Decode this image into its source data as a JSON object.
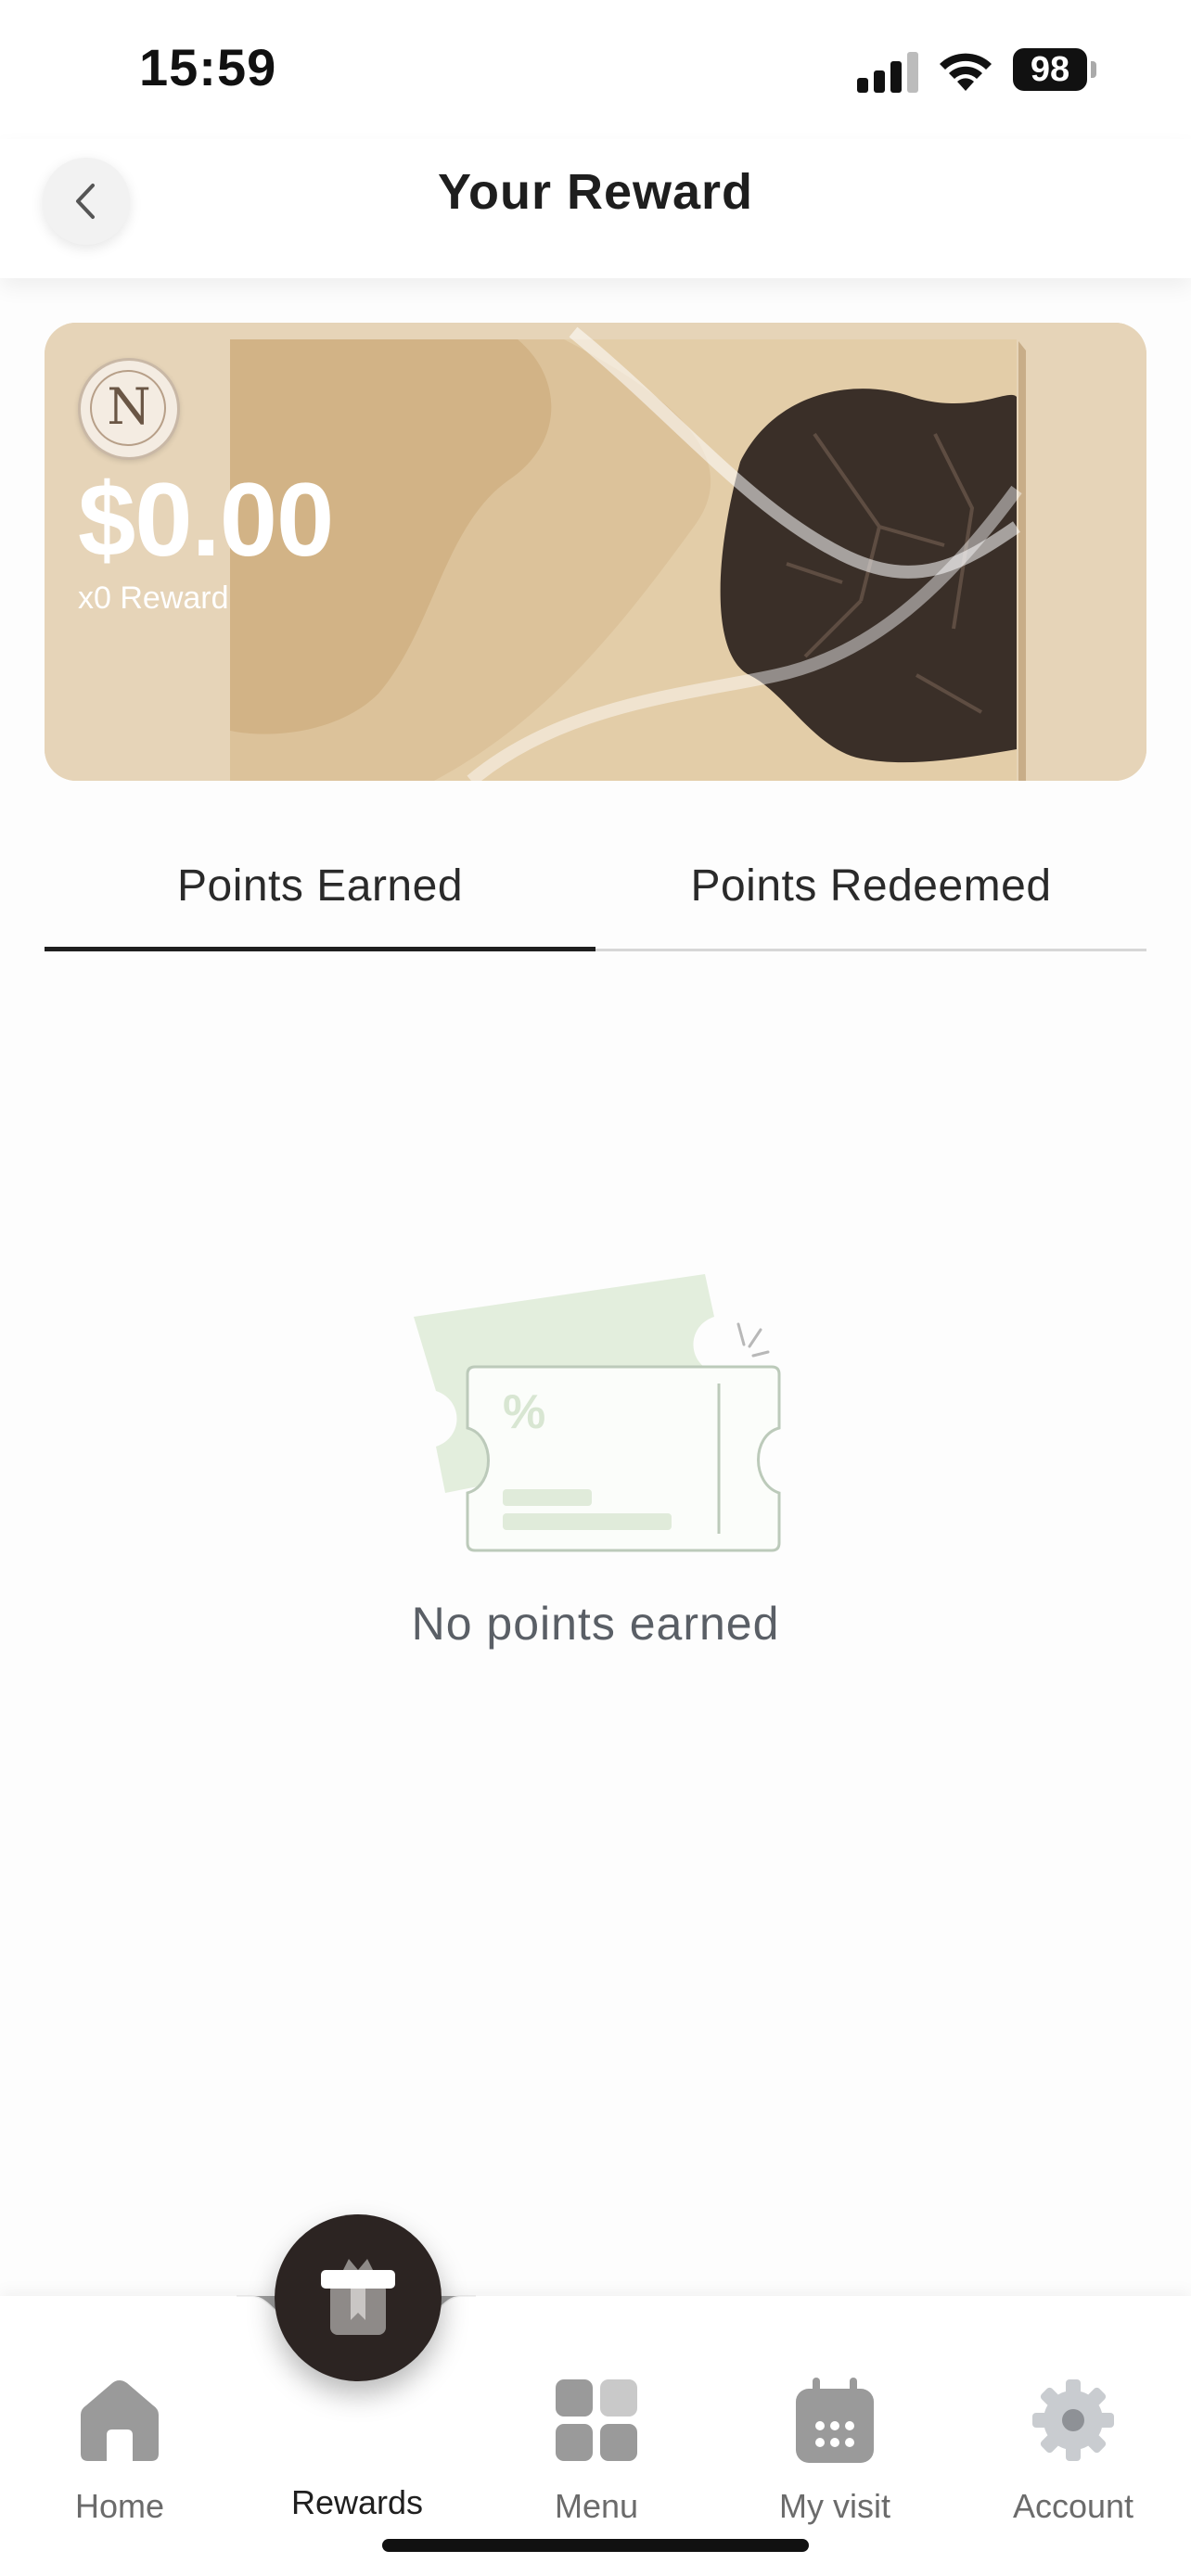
{
  "status_bar": {
    "time": "15:59",
    "battery": "98"
  },
  "header": {
    "title": "Your Reward"
  },
  "reward_card": {
    "logo_monogram": "N",
    "amount": "$0.00",
    "reward_count": "x0 Reward"
  },
  "tabs": [
    {
      "label": "Points Earned",
      "active": true
    },
    {
      "label": "Points Redeemed",
      "active": false
    }
  ],
  "empty_state": {
    "message": "No points earned",
    "illustration_symbol": "%"
  },
  "bottom_nav": {
    "items": [
      {
        "label": "Home",
        "icon": "home-icon"
      },
      {
        "label": "Rewards",
        "icon": "gift-icon",
        "active": true
      },
      {
        "label": "Menu",
        "icon": "grid-icon"
      },
      {
        "label": "My visit",
        "icon": "calendar-icon"
      },
      {
        "label": "Account",
        "icon": "gear-icon"
      }
    ]
  },
  "colors": {
    "accent_dark": "#2c2422",
    "card_beige": "#e6d4b6",
    "illustration_green": "#e3eedd",
    "inactive_icon": "#9a9a9a"
  }
}
